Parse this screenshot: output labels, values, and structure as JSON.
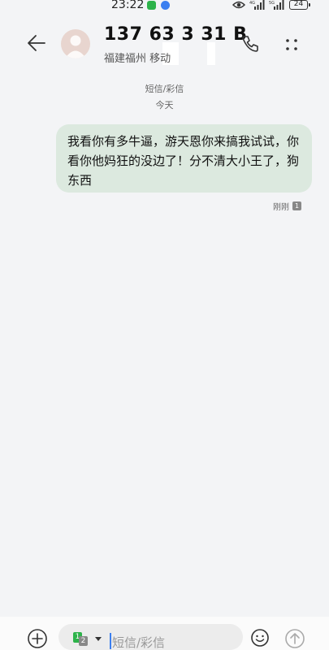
{
  "status_bar": {
    "time": "23:22",
    "battery": "24"
  },
  "header": {
    "contact_number": "137 63  3 31  B",
    "contact_location": "福建福州 移动"
  },
  "conversation": {
    "message_type": "短信/彩信",
    "date": "今天",
    "messages": [
      {
        "text": "我看你有多牛逼，游天恩你来搞我试试，你看你他妈狂的没边了！分不清大小王了，狗东西",
        "time": "刚刚",
        "sim": "1"
      }
    ]
  },
  "composer": {
    "placeholder": "短信/彩信",
    "sim_primary": "1",
    "sim_secondary": "2"
  },
  "colors": {
    "background": "#f3f4f6",
    "bubble": "#dce9df",
    "accent": "#3b7ff0",
    "sim_green": "#2db34a"
  }
}
